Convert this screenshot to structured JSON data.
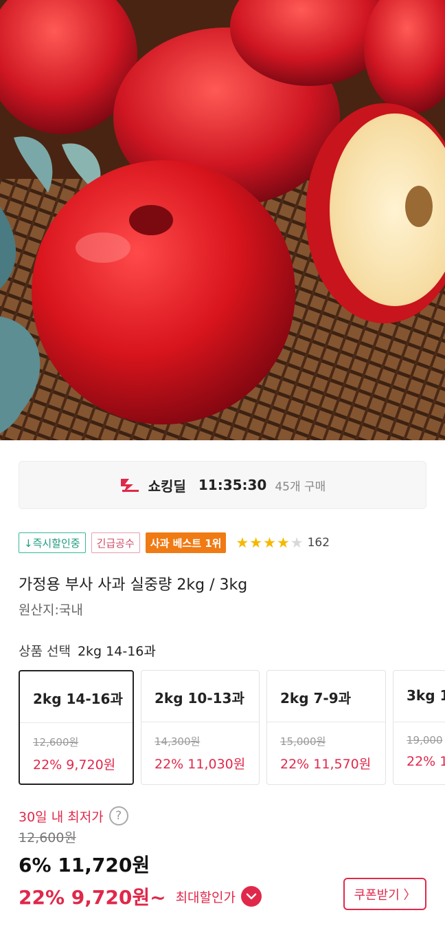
{
  "deal": {
    "icon": "shocking-deal-logo-icon",
    "name": "쇼킹딜",
    "timer": "11:35:30",
    "purchases": "45개 구매"
  },
  "badges": {
    "instant": "↓즉시할인중",
    "urgent": "긴급공수",
    "best": "사과 베스트 1위"
  },
  "rating": {
    "stars": 4,
    "max": 5,
    "count": "162"
  },
  "product": {
    "title": "가정용 부사 사과 실중량 2kg / 3kg",
    "origin": "원산지:국내"
  },
  "option_select": {
    "label": "상품 선택",
    "selected": "2kg 14-16과",
    "items": [
      {
        "name": "2kg 14-16과",
        "original": "12,600원",
        "price": "22% 9,720원",
        "selected": true
      },
      {
        "name": "2kg 10-13과",
        "original": "14,300원",
        "price": "22% 11,030원",
        "selected": false
      },
      {
        "name": "2kg 7-9과",
        "original": "15,000원",
        "price": "22% 11,570원",
        "selected": false
      },
      {
        "name": "3kg 1",
        "original": "19,000",
        "price": "22% 1",
        "selected": false
      }
    ]
  },
  "pricing": {
    "lowest_label": "30일 내 최저가",
    "help_icon": "?",
    "original": "12,600원",
    "discount_price": "6% 11,720원",
    "max_discount_price": "22% 9,720원~",
    "max_discount_label": "최대할인가",
    "coupon_button": "쿠폰받기 〉"
  },
  "colors": {
    "accent": "#e0284a",
    "best_badge": "#f07a13",
    "instant_badge": "#33b89a",
    "star": "#f5b800"
  }
}
